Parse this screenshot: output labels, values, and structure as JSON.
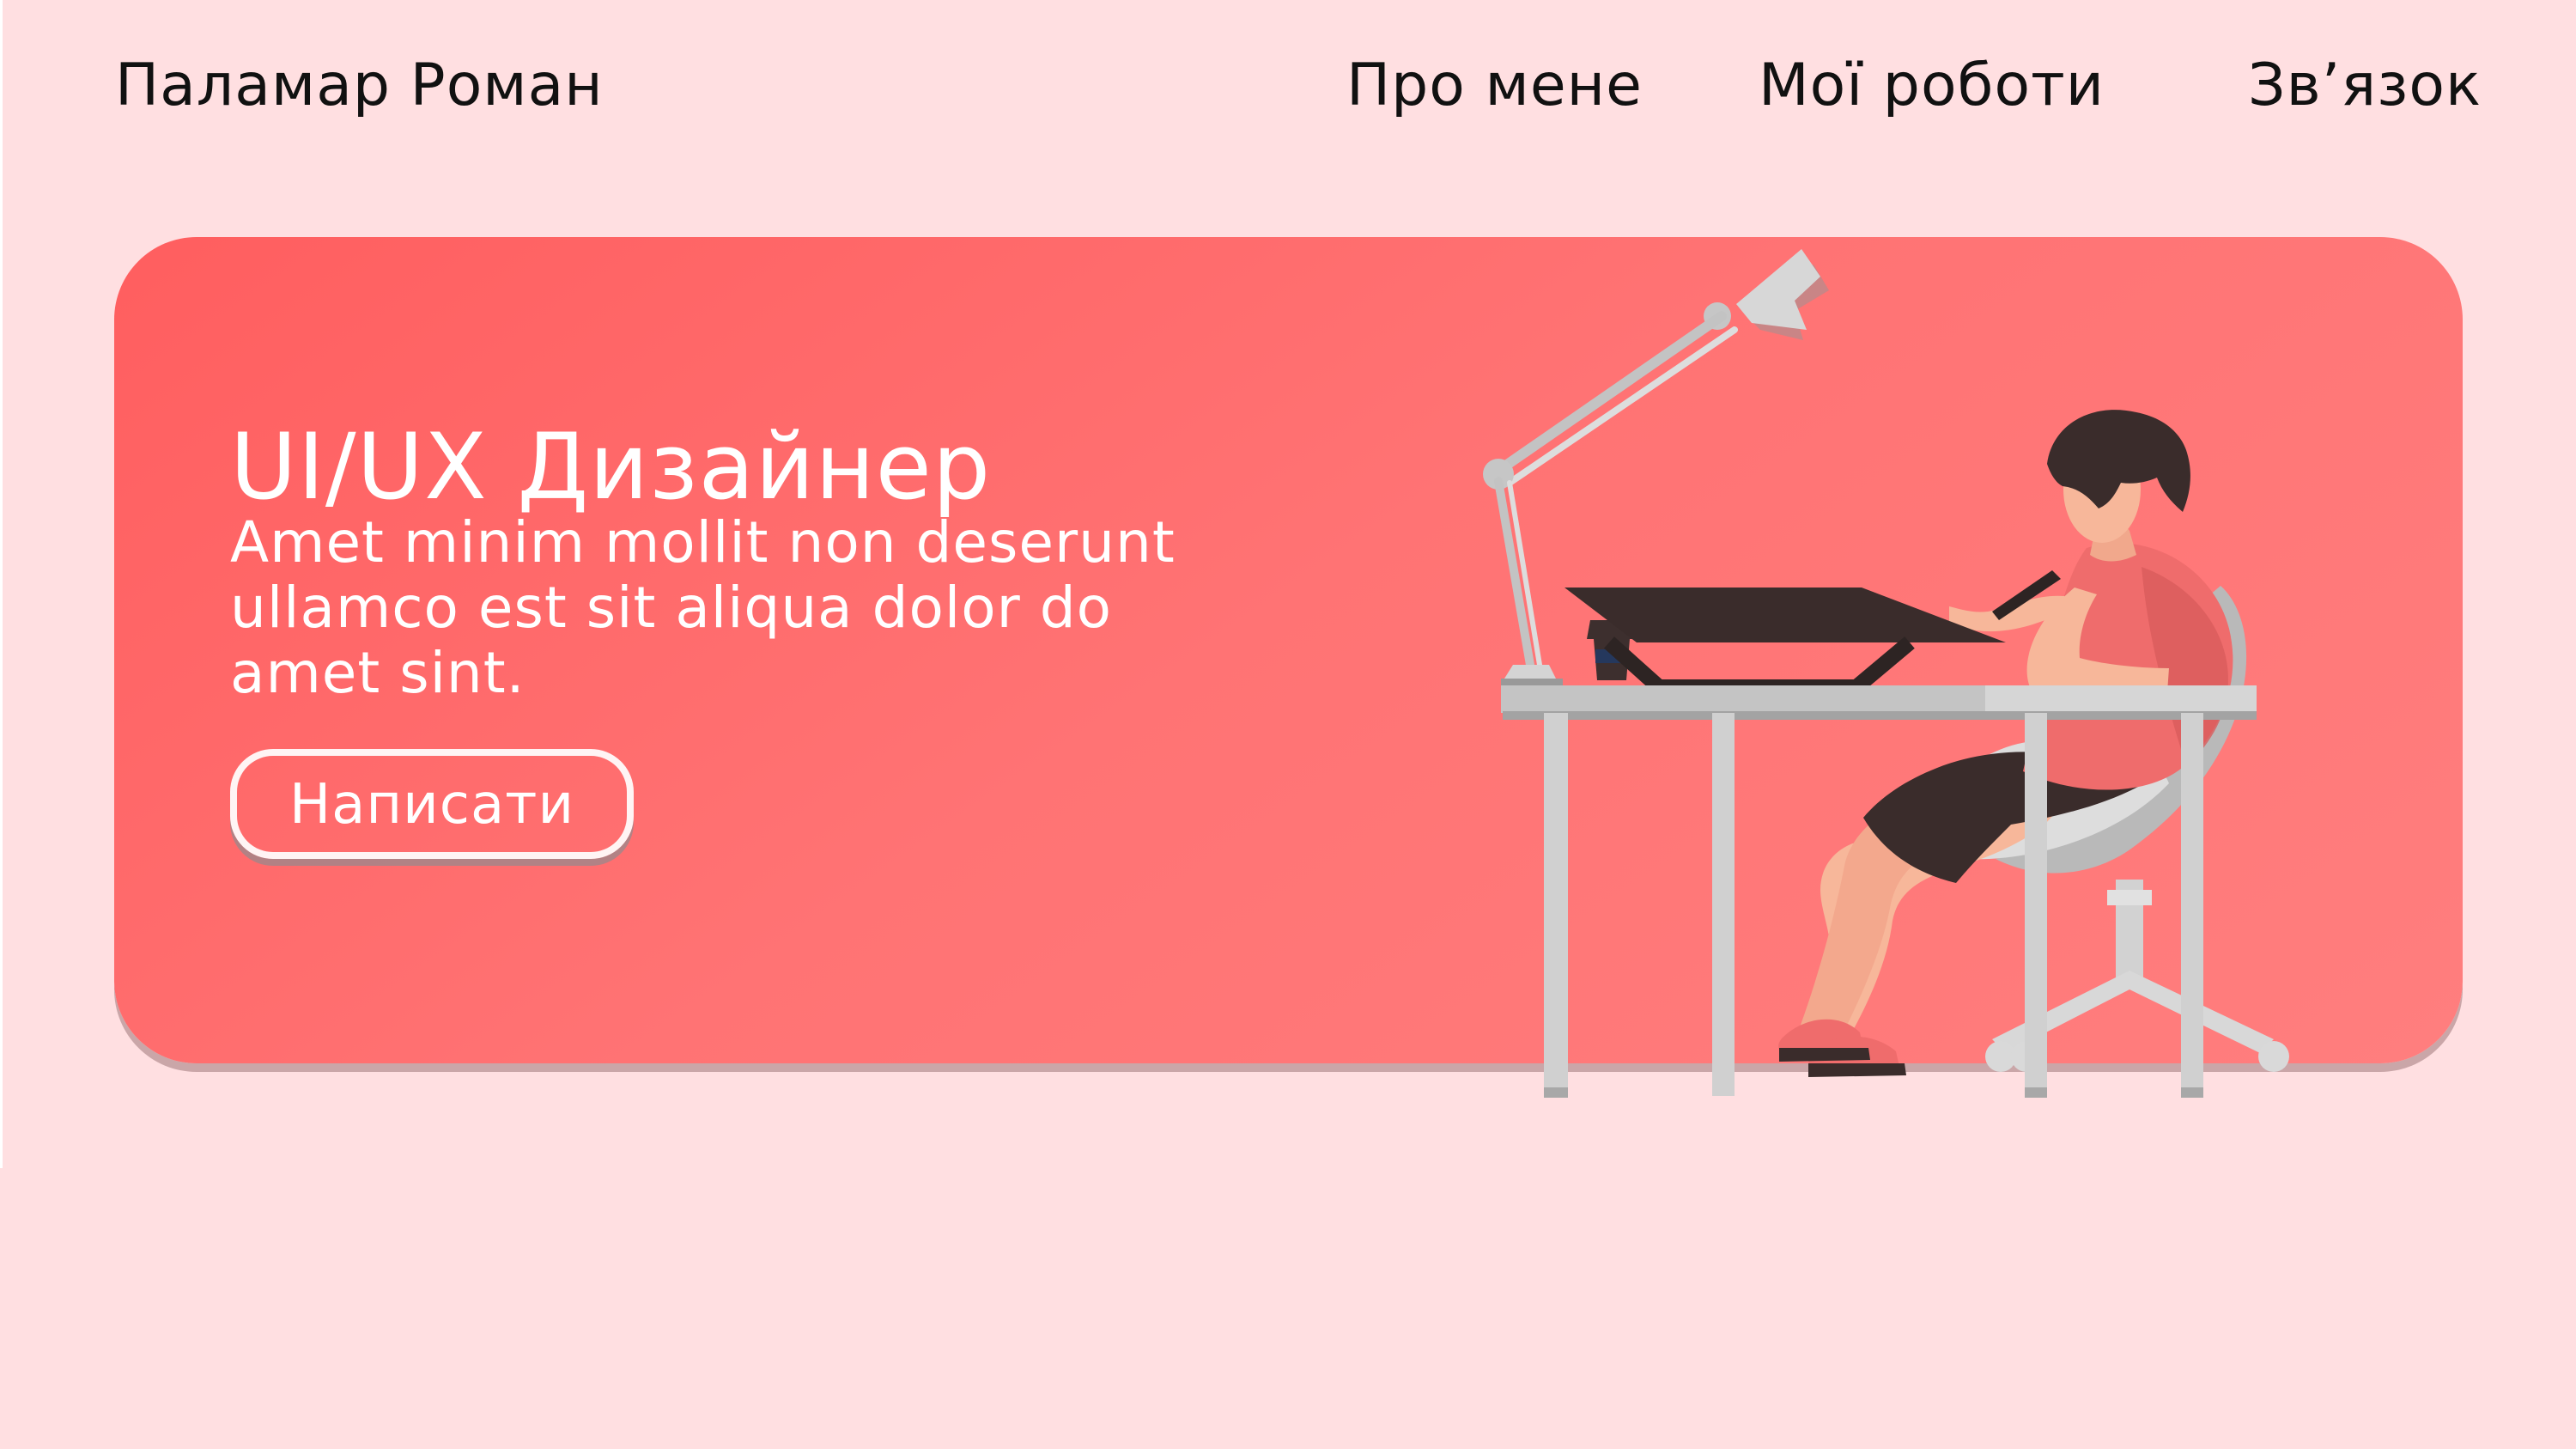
{
  "header": {
    "brand": "Паламар Роман",
    "nav": {
      "about": "Про мене",
      "works": "Мої роботи",
      "contact": "Звʼязок"
    }
  },
  "hero": {
    "title": "UI/UX Дизайнер",
    "description": "Amet minim mollit non deserunt ullamco est sit aliqua dolor do amet sint.",
    "button_label": "Написати"
  },
  "illustration": {
    "subject": "designer-at-desk-illustration"
  },
  "colors": {
    "page_background": "#ffdfe1",
    "hero_start": "#ff5e5f",
    "hero_end": "#ff7e7e",
    "text_dark": "#111111",
    "text_light": "#ffffff",
    "illustration_gray": "#c9c9c9",
    "illustration_dark": "#3a2c2b",
    "skin": "#f7b79a"
  }
}
